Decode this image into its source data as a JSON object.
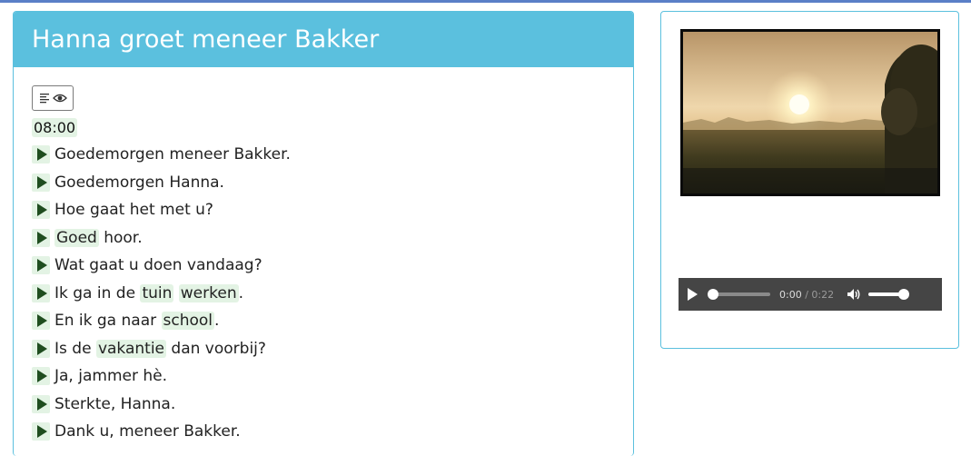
{
  "lesson": {
    "title": "Hanna groet meneer Bakker",
    "time": "08:00",
    "lines": [
      [
        {
          "t": "Goedemorgen meneer Bakker.",
          "h": false
        }
      ],
      [
        {
          "t": "Goedemorgen Hanna.",
          "h": false
        }
      ],
      [
        {
          "t": "Hoe gaat het met u?",
          "h": false
        }
      ],
      [
        {
          "t": "Goed",
          "h": true
        },
        {
          "t": " hoor.",
          "h": false
        }
      ],
      [
        {
          "t": "Wat gaat u doen vandaag?",
          "h": false
        }
      ],
      [
        {
          "t": "Ik ga in de ",
          "h": false
        },
        {
          "t": "tuin",
          "h": true
        },
        {
          "t": " ",
          "h": false
        },
        {
          "t": "werken",
          "h": true
        },
        {
          "t": ".",
          "h": false
        }
      ],
      [
        {
          "t": "En ik ga naar ",
          "h": false
        },
        {
          "t": "school",
          "h": true
        },
        {
          "t": ".",
          "h": false
        }
      ],
      [
        {
          "t": "Is de ",
          "h": false
        },
        {
          "t": "vakantie",
          "h": true
        },
        {
          "t": " dan voorbij?",
          "h": false
        }
      ],
      [
        {
          "t": "Ja, jammer hè.",
          "h": false
        }
      ],
      [
        {
          "t": "Sterkte, Hanna.",
          "h": false
        }
      ],
      [
        {
          "t": "Dank u, meneer Bakker.",
          "h": false
        }
      ]
    ]
  },
  "media": {
    "image_icon": "sunrise-landscape-photo",
    "audio": {
      "current_time": "0:00",
      "separator": " / ",
      "duration": "0:22",
      "progress": 0,
      "volume": 1.0
    }
  },
  "icons": {
    "transcript_toggle": [
      "text-lines-icon",
      "eye-icon"
    ],
    "line_play": "play-icon",
    "audio_play": "play-icon",
    "volume": "volume-icon"
  },
  "colors": {
    "header": "#5bc0de",
    "highlight": "#e3f3e4",
    "play_icon": "#1f4d1f",
    "player_bg": "#454545"
  }
}
